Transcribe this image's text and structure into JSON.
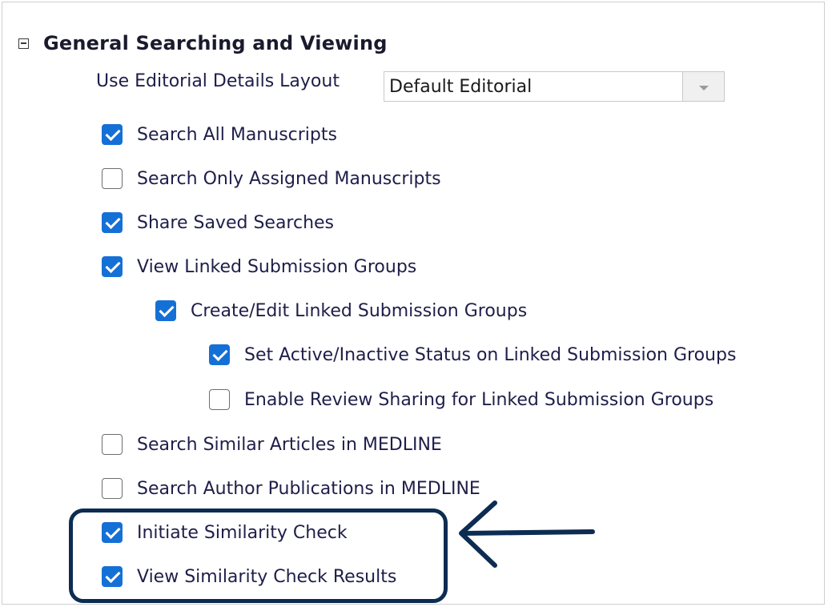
{
  "section": {
    "title": "General Searching and Viewing",
    "toggle_icon": "collapse-minus-icon"
  },
  "layout": {
    "label": "Use Editorial Details Layout",
    "selected": "Default Editorial"
  },
  "options": [
    {
      "label": "Search All Manuscripts",
      "checked": true
    },
    {
      "label": "Search Only Assigned Manuscripts",
      "checked": false
    },
    {
      "label": "Share Saved Searches",
      "checked": true
    },
    {
      "label": "View Linked Submission Groups",
      "checked": true
    },
    {
      "label": "Create/Edit Linked Submission Groups",
      "checked": true
    },
    {
      "label": "Set Active/Inactive Status on Linked Submission Groups",
      "checked": true
    },
    {
      "label": "Enable Review Sharing for Linked Submission Groups",
      "checked": false
    },
    {
      "label": "Search Similar Articles in MEDLINE",
      "checked": false
    },
    {
      "label": "Search Author Publications in MEDLINE",
      "checked": false
    },
    {
      "label": "Initiate Similarity Check",
      "checked": true
    },
    {
      "label": "View Similarity Check Results",
      "checked": true
    }
  ],
  "colors": {
    "checkbox_checked": "#1570d6",
    "label_text": "#1e1e4a",
    "annotation": "#0d2c52"
  }
}
